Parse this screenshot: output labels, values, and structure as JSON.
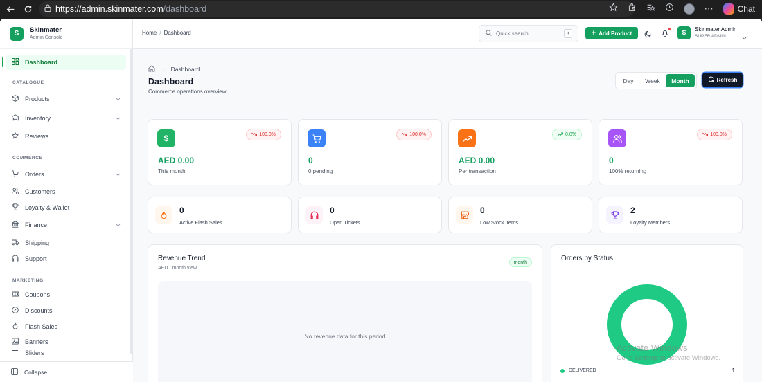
{
  "browser": {
    "url_host": "https://admin.skinmater.com",
    "url_path": "/dashboard",
    "chat_label": "Chat"
  },
  "brand": {
    "name": "Skinmater",
    "subtitle": "Admin Console",
    "logo_letter": "S"
  },
  "sidebar": {
    "dashboard": "Dashboard",
    "section_catalogue": "CATALOGUE",
    "products": "Products",
    "inventory": "Inventory",
    "reviews": "Reviews",
    "section_commerce": "COMMERCE",
    "orders": "Orders",
    "customers": "Customers",
    "loyalty": "Loyalty & Wallet",
    "finance": "Finance",
    "shipping": "Shipping",
    "support": "Support",
    "section_marketing": "MARKETING",
    "coupons": "Coupons",
    "discounts": "Discounts",
    "flash_sales": "Flash Sales",
    "banners": "Banners",
    "sliders": "Sliders",
    "collapse": "Collapse"
  },
  "topbar": {
    "crumb_home": "Home",
    "crumb_sep": "/",
    "crumb_current": "Dashboard",
    "search_placeholder": "Quick search",
    "search_key": "K",
    "add_product": "Add Product",
    "user_name": "Skinmater Admin",
    "user_role": "SUPER ADMIN",
    "user_initial": "S"
  },
  "page": {
    "crumb": "Dashboard",
    "title": "Dashboard",
    "subtitle": "Commerce operations overview",
    "range_day": "Day",
    "range_week": "Week",
    "range_month": "Month",
    "selected_range": "Month",
    "refresh": "Refresh"
  },
  "stats": [
    {
      "value": "AED 0.00",
      "label": "This month",
      "trend": "100.0%",
      "trend_dir": "down",
      "color": "#22b466",
      "icon": "dollar-icon"
    },
    {
      "value": "0",
      "label": "0 pending",
      "trend": "100.0%",
      "trend_dir": "down",
      "color": "#3b82f6",
      "icon": "cart-icon"
    },
    {
      "value": "AED 0.00",
      "label": "Per transaction",
      "trend": "0.0%",
      "trend_dir": "up",
      "color": "#f97316",
      "icon": "trending-up-icon"
    },
    {
      "value": "0",
      "label": "100% returning",
      "trend": "100.0%",
      "trend_dir": "down",
      "color": "#a855f7",
      "icon": "users-icon"
    }
  ],
  "mini_stats": [
    {
      "value": "0",
      "label": "Active Flash Sales",
      "icon": "flame-icon"
    },
    {
      "value": "0",
      "label": "Open Tickets",
      "icon": "headphones-icon"
    },
    {
      "value": "0",
      "label": "Low Stock Items",
      "icon": "store-icon"
    },
    {
      "value": "2",
      "label": "Loyalty Members",
      "icon": "trophy-icon"
    }
  ],
  "revenue": {
    "title": "Revenue Trend",
    "subtitle": "AED · month view",
    "badge": "month",
    "empty_text": "No revenue data for this period"
  },
  "orders_status": {
    "title": "Orders by Status",
    "legend_label": "DELIVERED",
    "legend_count": "1"
  },
  "watermark": {
    "line1": "Activate Windows",
    "line2": "Go to Settings to activate Windows."
  },
  "colors": {
    "brand": "#15a05f",
    "donut": "#1fca84"
  }
}
